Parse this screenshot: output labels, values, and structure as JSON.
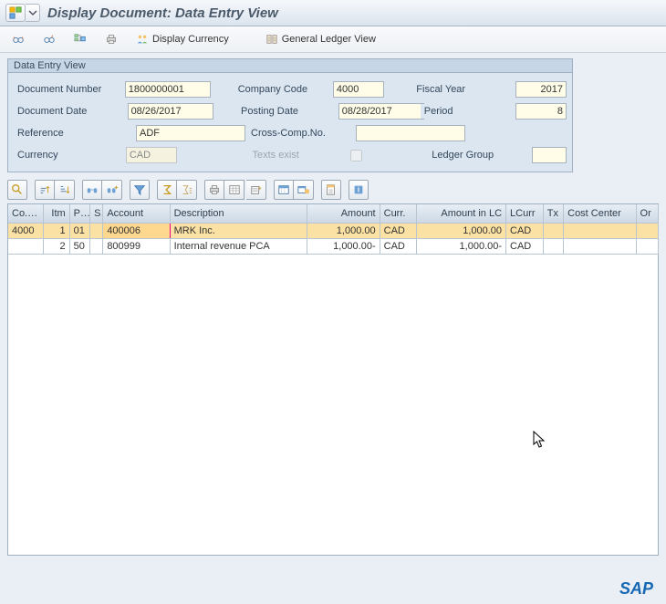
{
  "header": {
    "title": "Display Document: Data Entry View"
  },
  "toolbar": {
    "display_currency": "Display Currency",
    "general_ledger_view": "General Ledger View"
  },
  "panel": {
    "title": "Data Entry View",
    "fields": {
      "document_number_label": "Document Number",
      "document_number": "1800000001",
      "company_code_label": "Company Code",
      "company_code": "4000",
      "fiscal_year_label": "Fiscal Year",
      "fiscal_year": "2017",
      "document_date_label": "Document Date",
      "document_date": "08/26/2017",
      "posting_date_label": "Posting Date",
      "posting_date": "08/28/2017",
      "period_label": "Period",
      "period": "8",
      "reference_label": "Reference",
      "reference": "ADF",
      "cross_comp_no_label": "Cross-Comp.No.",
      "cross_comp_no": "",
      "currency_label": "Currency",
      "currency": "CAD",
      "texts_exist_label": "Texts exist",
      "texts_exist": false,
      "ledger_group_label": "Ledger Group",
      "ledger_group": ""
    }
  },
  "grid": {
    "columns": {
      "co": "Co...",
      "itm": "Itm",
      "pk": "PK",
      "s": "S",
      "account": "Account",
      "description": "Description",
      "amount": "Amount",
      "curr": "Curr.",
      "amount_lc": "Amount in LC",
      "lcurr": "LCurr",
      "tx": "Tx",
      "cost_center": "Cost Center",
      "order": "Or"
    },
    "rows": [
      {
        "co": "4000",
        "itm": "1",
        "pk": "01",
        "s": "",
        "account": "400006",
        "description": "MRK Inc.",
        "amount": "1,000.00",
        "curr": "CAD",
        "amount_lc": "1,000.00",
        "lcurr": "CAD",
        "tx": "",
        "cost_center": "",
        "order": "",
        "_selected": true
      },
      {
        "co": "",
        "itm": "2",
        "pk": "50",
        "s": "",
        "account": "800999",
        "description": "Internal revenue PCA",
        "amount": "1,000.00-",
        "curr": "CAD",
        "amount_lc": "1,000.00-",
        "lcurr": "CAD",
        "tx": "",
        "cost_center": "",
        "order": "",
        "_selected": false
      }
    ]
  },
  "footer": {
    "sap": "SAP"
  }
}
